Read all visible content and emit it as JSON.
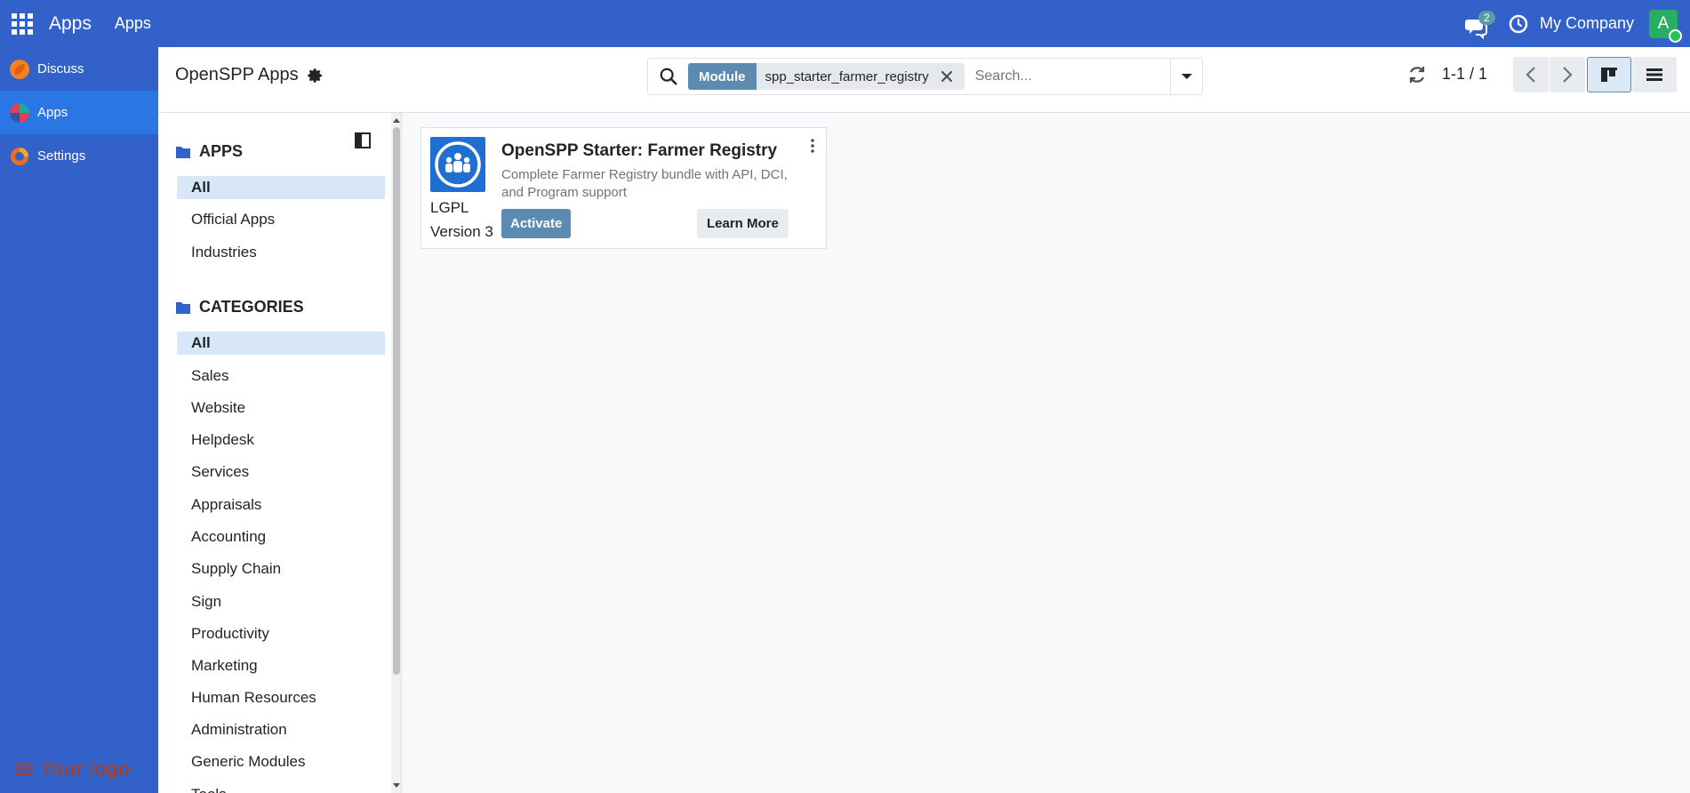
{
  "topbar": {
    "brand": "Apps",
    "menu_item": "Apps",
    "chat_count": "2",
    "company": "My Company",
    "avatar_initial": "A"
  },
  "app_sidebar": {
    "items": [
      {
        "label": "Discuss",
        "icon": "discuss-icon"
      },
      {
        "label": "Apps",
        "icon": "apps-icon"
      },
      {
        "label": "Settings",
        "icon": "settings-icon"
      }
    ],
    "logo_text": "Your logo"
  },
  "control_panel": {
    "breadcrumb": "OpenSPP Apps",
    "search": {
      "facet_label": "Module",
      "facet_value": "spp_starter_farmer_registry",
      "placeholder": "Search..."
    },
    "pager": "1-1 / 1"
  },
  "filter_panel": {
    "apps": {
      "title": "APPS",
      "items": [
        "All",
        "Official Apps",
        "Industries"
      ]
    },
    "categories": {
      "title": "CATEGORIES",
      "items": [
        "All",
        "Sales",
        "Website",
        "Helpdesk",
        "Services",
        "Appraisals",
        "Accounting",
        "Supply Chain",
        "Sign",
        "Productivity",
        "Marketing",
        "Human Resources",
        "Administration",
        "Generic Modules",
        "Tools"
      ]
    }
  },
  "kanban": {
    "cards": [
      {
        "title": "OpenSPP Starter: Farmer Registry",
        "description": "Complete Farmer Registry bundle with API, DCI, and Program support",
        "license_line1": "LGPL",
        "license_line2": "Version 3",
        "activate_label": "Activate",
        "learn_more_label": "Learn More"
      }
    ]
  },
  "colors": {
    "navbar": "#3161c9",
    "accent": "#5d8ab0",
    "active_filter": "#d7e7f8"
  }
}
